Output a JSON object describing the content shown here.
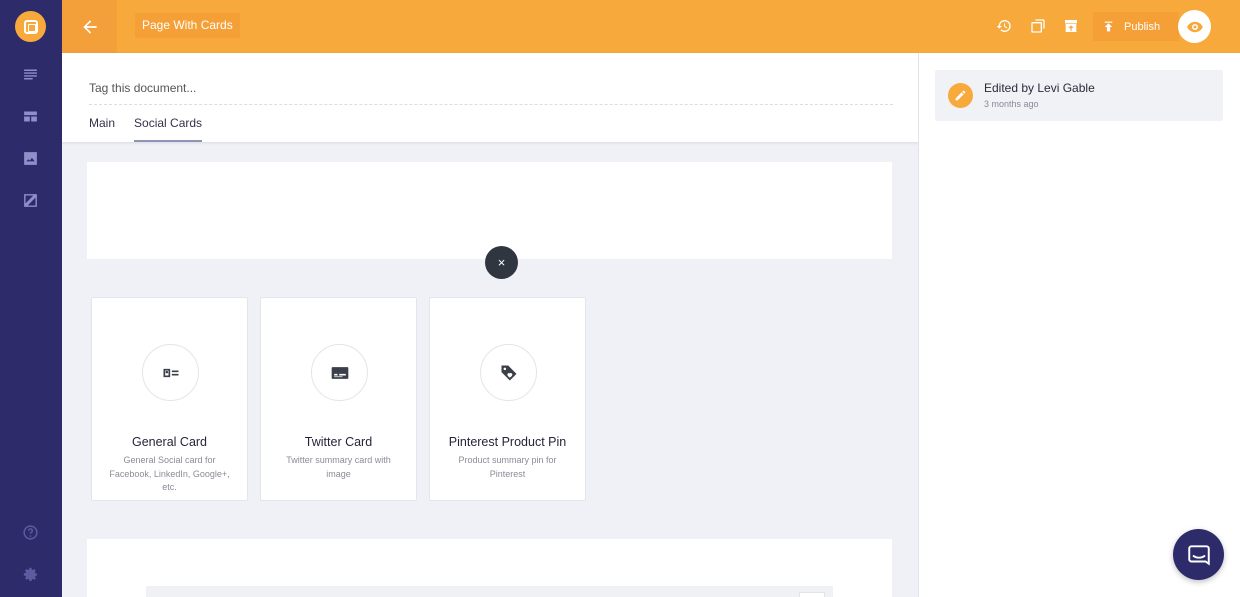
{
  "topbar": {
    "document_title": "Page With Cards",
    "publish_label": "Publish"
  },
  "editor": {
    "tag_placeholder": "Tag this document...",
    "tabs": [
      {
        "label": "Main",
        "active": false
      },
      {
        "label": "Social Cards",
        "active": true
      }
    ],
    "close_symbol": "×"
  },
  "cards": [
    {
      "title": "General Card",
      "description": "General Social card for Facebook, LinkedIn, Google+, etc.",
      "icon": "id-card-icon"
    },
    {
      "title": "Twitter Card",
      "description": "Twitter summary card with image",
      "icon": "subtitles-icon"
    },
    {
      "title": "Pinterest Product Pin",
      "description": "Product summary pin for Pinterest",
      "icon": "price-tag-icon"
    }
  ],
  "history": {
    "edited_by": "Edited by Levi Gable",
    "time_ago": "3 months ago"
  },
  "colors": {
    "accent": "#f7a93c",
    "rail": "#2e2b6b",
    "background": "#f0f1f7"
  }
}
